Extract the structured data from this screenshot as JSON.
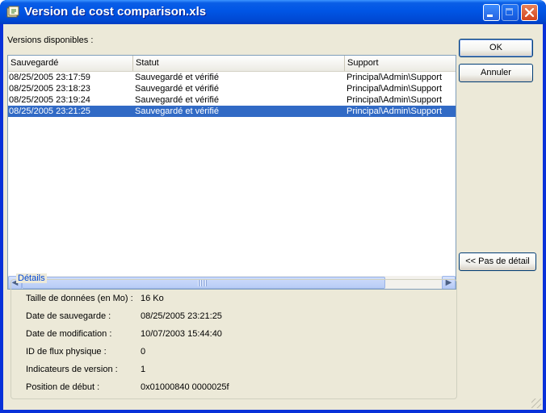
{
  "window": {
    "title": "Version de cost comparison.xls",
    "colors": {
      "titlebar": "#0055e5",
      "selection": "#316ac5",
      "group_title": "#0046d5",
      "close_button": "#d2441c"
    },
    "icons": {
      "app": "version-app-icon",
      "minimize": "minimize-icon",
      "maximize": "maximize-icon",
      "close": "close-icon"
    }
  },
  "versions_label": "Versions disponibles :",
  "list": {
    "columns": [
      "Sauvegardé",
      "Statut",
      "Support"
    ],
    "rows": [
      {
        "saved": "08/25/2005 23:17:59",
        "status": "Sauvegardé et vérifié",
        "support": "Principal\\Admin\\Support"
      },
      {
        "saved": "08/25/2005 23:18:23",
        "status": "Sauvegardé et vérifié",
        "support": "Principal\\Admin\\Support"
      },
      {
        "saved": "08/25/2005 23:19:24",
        "status": "Sauvegardé et vérifié",
        "support": "Principal\\Admin\\Support"
      },
      {
        "saved": "08/25/2005 23:21:25",
        "status": "Sauvegardé et vérifié",
        "support": "Principal\\Admin\\Support",
        "selected": true
      }
    ]
  },
  "buttons": {
    "ok": "OK",
    "cancel": "Annuler",
    "details": "<< Pas de détail"
  },
  "details": {
    "title": "Détails",
    "items": [
      {
        "label": "Taille de données (en Mo) :",
        "value": "16 Ko"
      },
      {
        "label": "Date de sauvegarde :",
        "value": "08/25/2005 23:21:25"
      },
      {
        "label": "Date de modification :",
        "value": "10/07/2003 15:44:40"
      },
      {
        "label": "ID de flux physique :",
        "value": "0"
      },
      {
        "label": "Indicateurs de version :",
        "value": "1"
      },
      {
        "label": "Position de début :",
        "value": "0x01000840 0000025f"
      }
    ]
  }
}
